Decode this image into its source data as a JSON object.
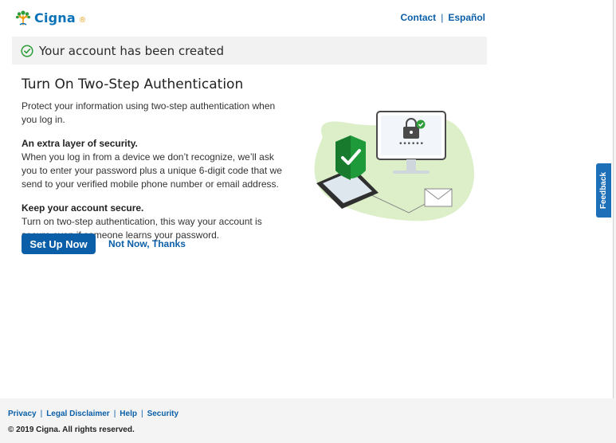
{
  "header": {
    "logo_text": "Cigna",
    "logo_mark": "®",
    "links": {
      "contact": "Contact",
      "separator": "|",
      "espanol": "Español"
    }
  },
  "banner": {
    "icon": "check-circle-icon",
    "text": "Your account has been created"
  },
  "main": {
    "title": "Turn On Two-Step Authentication",
    "intro": "Protect your information using two-step authentication when you log in.",
    "section1": {
      "heading": "An extra layer of security.",
      "body": "When you log in from a device we don’t recognize, we’ll ask you to enter your password plus a unique 6-digit code that we send to your verified mobile phone number or email address."
    },
    "section2": {
      "heading": "Keep your account secure.",
      "body": "Turn on two-step authentication, this way your account is secure even if someone learns your password."
    },
    "primary_button": "Set Up Now",
    "secondary_link": "Not Now, Thanks"
  },
  "illustration": {
    "password_dots": "••••••"
  },
  "feedback_tab": {
    "label": "Feedback"
  },
  "footer": {
    "links": [
      "Privacy",
      "Legal Disclaimer",
      "Help",
      "Security"
    ],
    "separator": "|",
    "copyright": "© 2019 Cigna. All rights reserved."
  },
  "colors": {
    "brand_blue": "#0a5fa8",
    "logo_blue": "#0a72b8",
    "success_green": "#2e9e3b",
    "shield_green": "#1f9a3a",
    "illustration_bg": "#dcefc8"
  }
}
